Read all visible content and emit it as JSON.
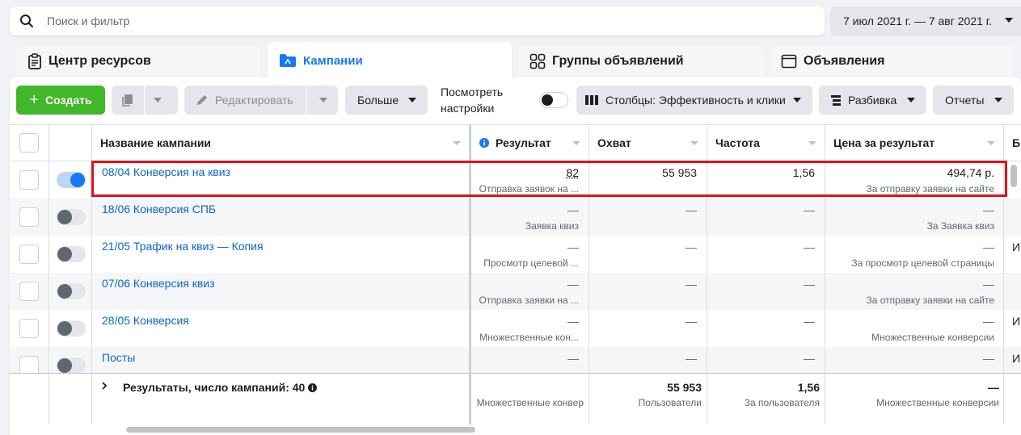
{
  "search": {
    "placeholder": "Поиск и фильтр"
  },
  "date_range": "7 июл 2021 г. — 7 авг 2021 г.",
  "tabs": [
    {
      "label": "Центр ресурсов",
      "icon": "clipboard-icon"
    },
    {
      "label": "Кампании",
      "icon": "folder-icon",
      "active": true
    },
    {
      "label": "Группы объявлений",
      "icon": "grid-icon"
    },
    {
      "label": "Объявления",
      "icon": "window-icon"
    }
  ],
  "toolbar": {
    "create": "Создать",
    "edit": "Редактировать",
    "more": "Больше",
    "view_settings_line1": "Посмотреть",
    "view_settings_line2": "настройки",
    "columns": "Столбцы: Эффективность и клики",
    "breakdown": "Разбивка",
    "reports": "Отчеты"
  },
  "columns": {
    "name": "Название кампании",
    "result": "Результат",
    "reach": "Охват",
    "frequency": "Частота",
    "cost": "Цена за результат",
    "extra": "Б"
  },
  "rows": [
    {
      "name": "08/04 Конверсия на квиз",
      "on": true,
      "result": "82",
      "result_sub": "Отправка заявок на ...",
      "reach": "55 953",
      "frequency": "1,56",
      "cost": "494,74 р.",
      "cost_sub": "За отправку заявки на сайте",
      "extra": ""
    },
    {
      "name": "18/06 Конверсия СПБ",
      "on": false,
      "result": "—",
      "result_sub": "Заявка квиз",
      "reach": "—",
      "frequency": "—",
      "cost": "—",
      "cost_sub": "За Заявка квиз",
      "extra": ""
    },
    {
      "name": "21/05 Трафик на квиз — Копия",
      "on": false,
      "result": "—",
      "result_sub": "Просмотр целевой ...",
      "reach": "—",
      "frequency": "—",
      "cost": "—",
      "cost_sub": "За просмотр целевой страницы",
      "extra": "И"
    },
    {
      "name": "07/06 Конверсия квиз",
      "on": false,
      "result": "—",
      "result_sub": "Отправка заявки на ...",
      "reach": "—",
      "frequency": "—",
      "cost": "—",
      "cost_sub": "За отправку заявки на сайте",
      "extra": ""
    },
    {
      "name": "28/05 Конверсия",
      "on": false,
      "result": "—",
      "result_sub": "Множественные кон...",
      "reach": "—",
      "frequency": "—",
      "cost": "—",
      "cost_sub": "Множественные конверсии",
      "extra": "И"
    },
    {
      "name": "Посты",
      "on": false,
      "result": "—",
      "result_sub": "",
      "reach": "—",
      "frequency": "—",
      "cost": "—",
      "cost_sub": "",
      "extra": "И"
    }
  ],
  "totals": {
    "label": "Результаты, число кампаний: 40",
    "result_sub": "Множественные конвер",
    "reach": "55 953",
    "reach_sub": "Пользователи",
    "frequency": "1,56",
    "frequency_sub": "За пользователя",
    "cost": "—",
    "cost_sub": "Множественные конверсии"
  },
  "highlight_color": "#e0101a"
}
